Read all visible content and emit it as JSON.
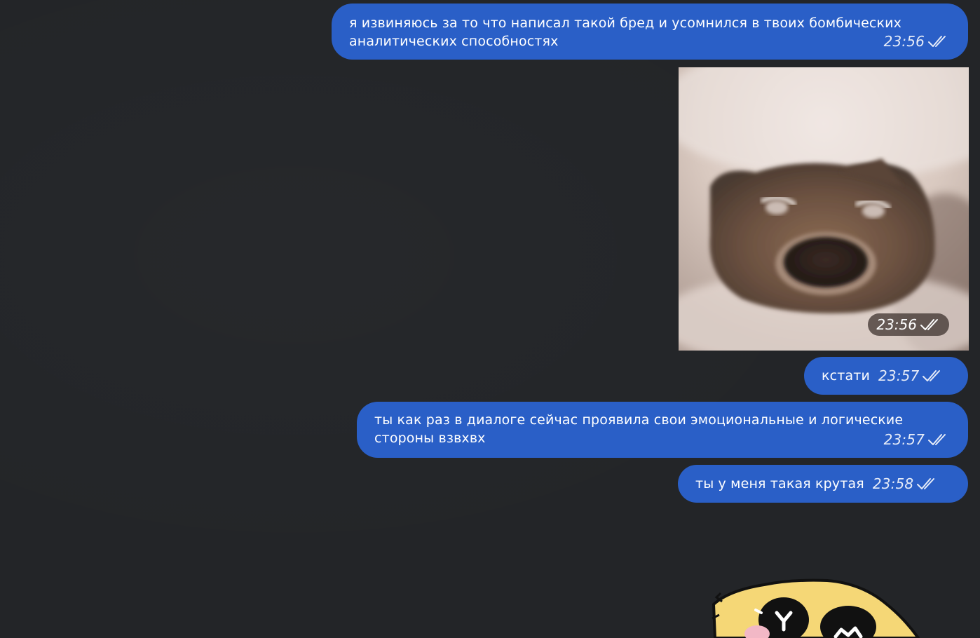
{
  "messages": [
    {
      "text": "я извиняюсь за то что написал такой бред и усомнился в твоих бомбических аналитических способностях",
      "time": "23:56"
    },
    {
      "time": "23:56"
    },
    {
      "text": "кстати",
      "time": "23:57"
    },
    {
      "text": "ты как раз в диалоге сейчас проявила свои эмоциональные и логические стороны взвхвх",
      "time": "23:57"
    },
    {
      "text": "ты у меня такая крутая",
      "time": "23:58"
    }
  ],
  "colors": {
    "background": "#232528",
    "outgoing_bubble": "#2a5fc7",
    "text": "#ffffff"
  },
  "icons": {
    "read_receipt": "double-check-icon"
  }
}
